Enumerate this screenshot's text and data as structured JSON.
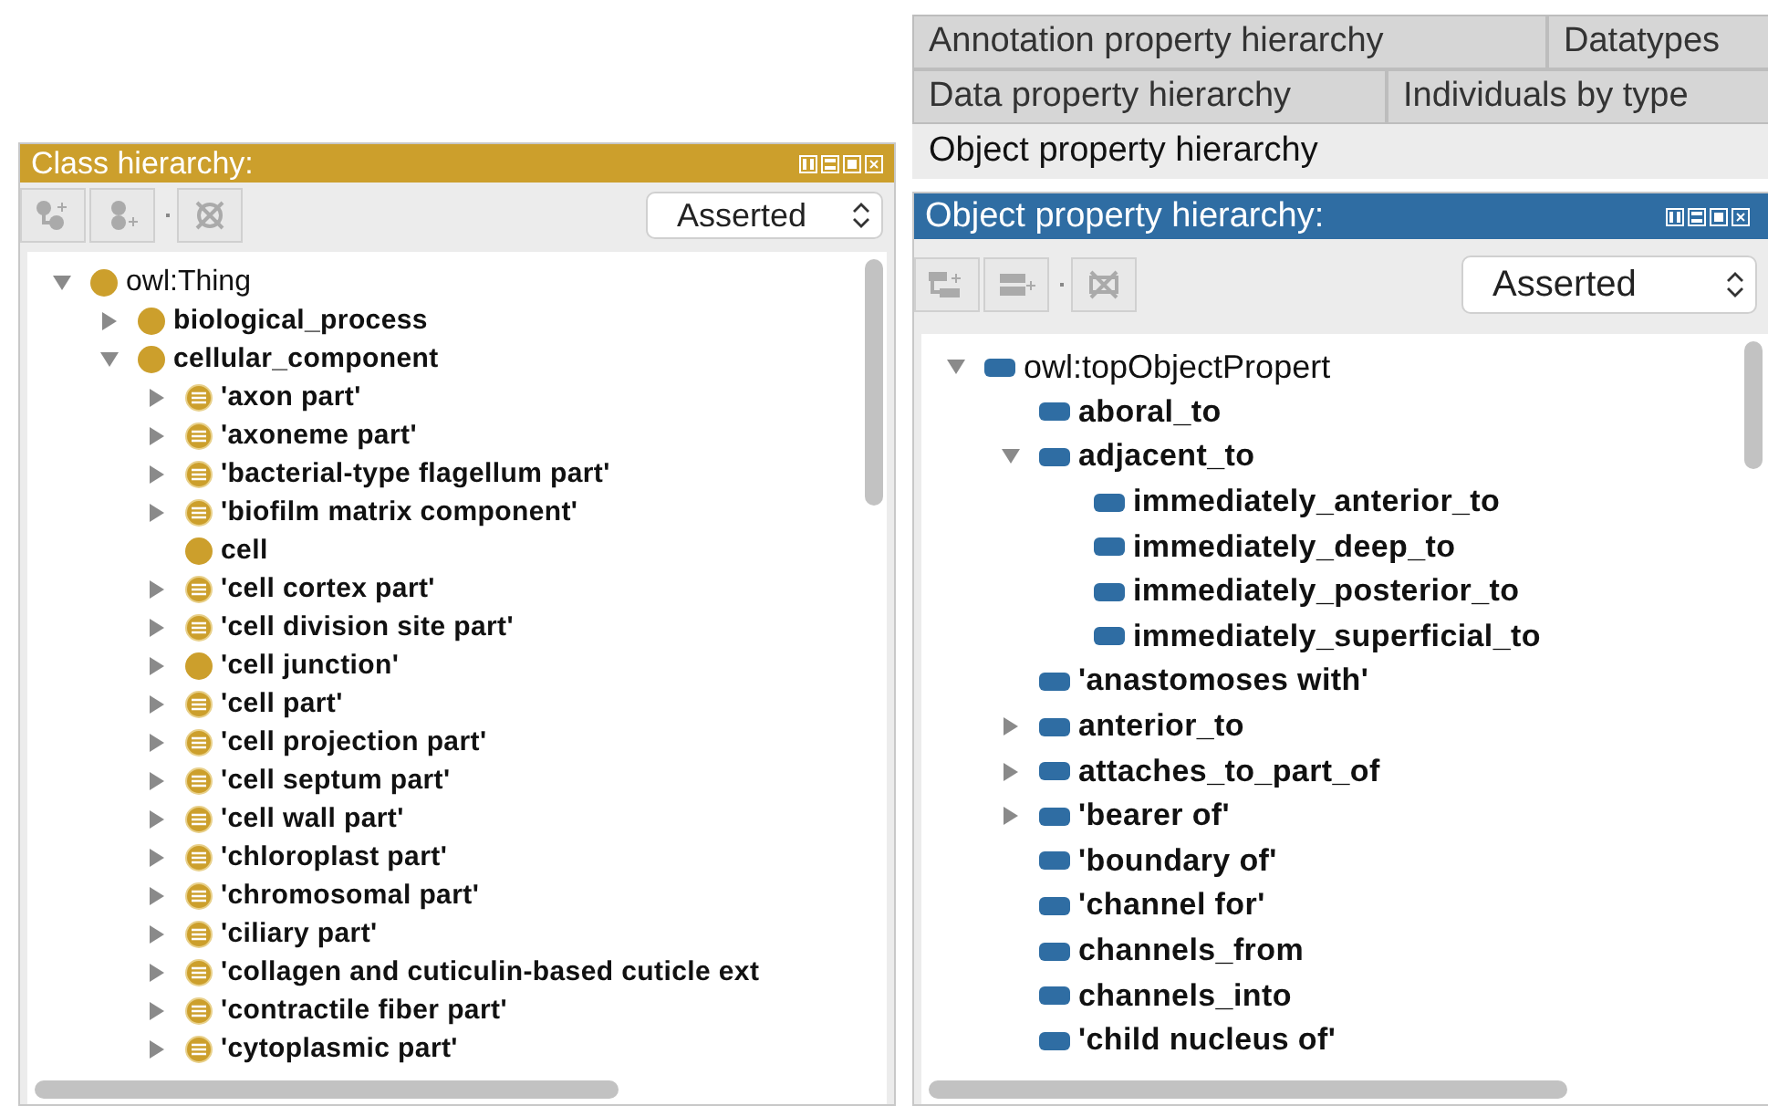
{
  "class_panel": {
    "title": "Class hierarchy:",
    "color": "#cc9f2c",
    "mode": "Asserted",
    "tree": [
      {
        "label": "owl:Thing",
        "kind": "class",
        "bold": false,
        "expanded": true,
        "children": [
          {
            "label": "biological_process",
            "kind": "class",
            "bold": true,
            "expanded": false
          },
          {
            "label": "cellular_component",
            "kind": "class",
            "bold": true,
            "expanded": true,
            "children": [
              {
                "label": "'axon part'",
                "kind": "defined-class",
                "bold": true,
                "expanded": false
              },
              {
                "label": "'axoneme part'",
                "kind": "defined-class",
                "bold": true,
                "expanded": false
              },
              {
                "label": "'bacterial-type flagellum part'",
                "kind": "defined-class",
                "bold": true,
                "expanded": false
              },
              {
                "label": "'biofilm matrix component'",
                "kind": "defined-class",
                "bold": true,
                "expanded": false
              },
              {
                "label": "cell",
                "kind": "class",
                "bold": true
              },
              {
                "label": "'cell cortex part'",
                "kind": "defined-class",
                "bold": true,
                "expanded": false
              },
              {
                "label": "'cell division site part'",
                "kind": "defined-class",
                "bold": true,
                "expanded": false
              },
              {
                "label": "'cell junction'",
                "kind": "class",
                "bold": true,
                "expanded": false
              },
              {
                "label": "'cell part'",
                "kind": "defined-class",
                "bold": true,
                "expanded": false
              },
              {
                "label": "'cell projection part'",
                "kind": "defined-class",
                "bold": true,
                "expanded": false
              },
              {
                "label": "'cell septum part'",
                "kind": "defined-class",
                "bold": true,
                "expanded": false
              },
              {
                "label": "'cell wall part'",
                "kind": "defined-class",
                "bold": true,
                "expanded": false
              },
              {
                "label": "'chloroplast part'",
                "kind": "defined-class",
                "bold": true,
                "expanded": false
              },
              {
                "label": "'chromosomal part'",
                "kind": "defined-class",
                "bold": true,
                "expanded": false
              },
              {
                "label": "'ciliary part'",
                "kind": "defined-class",
                "bold": true,
                "expanded": false
              },
              {
                "label": "'collagen and cuticulin-based cuticle ext",
                "kind": "defined-class",
                "bold": true,
                "expanded": false
              },
              {
                "label": "'contractile fiber part'",
                "kind": "defined-class",
                "bold": true,
                "expanded": false
              },
              {
                "label": "'cytoplasmic part'",
                "kind": "defined-class",
                "bold": true,
                "expanded": false
              }
            ]
          }
        ]
      }
    ]
  },
  "tab_rows": [
    [
      {
        "label": "Annotation property hierarchy",
        "selected": false
      },
      {
        "label": "Datatypes",
        "selected": false
      }
    ],
    [
      {
        "label": "Data property hierarchy",
        "selected": false
      },
      {
        "label": "Individuals by type",
        "selected": false
      }
    ],
    [
      {
        "label": "Object property hierarchy",
        "selected": true
      }
    ]
  ],
  "property_panel": {
    "title": "Object property hierarchy:",
    "color": "#2f6da3",
    "mode": "Asserted",
    "tree": [
      {
        "label": "owl:topObjectPropert",
        "kind": "property",
        "bold": false,
        "expanded": true,
        "children": [
          {
            "label": "aboral_to",
            "kind": "property",
            "bold": true
          },
          {
            "label": "adjacent_to",
            "kind": "property",
            "bold": true,
            "expanded": true,
            "children": [
              {
                "label": "immediately_anterior_to",
                "kind": "property",
                "bold": true
              },
              {
                "label": "immediately_deep_to",
                "kind": "property",
                "bold": true
              },
              {
                "label": "immediately_posterior_to",
                "kind": "property",
                "bold": true
              },
              {
                "label": "immediately_superficial_to",
                "kind": "property",
                "bold": true
              }
            ]
          },
          {
            "label": "'anastomoses with'",
            "kind": "property",
            "bold": true
          },
          {
            "label": "anterior_to",
            "kind": "property",
            "bold": true,
            "expanded": false
          },
          {
            "label": "attaches_to_part_of",
            "kind": "property",
            "bold": true,
            "expanded": false
          },
          {
            "label": "'bearer of'",
            "kind": "property",
            "bold": true,
            "expanded": false
          },
          {
            "label": "'boundary of'",
            "kind": "property",
            "bold": true
          },
          {
            "label": "'channel for'",
            "kind": "property",
            "bold": true
          },
          {
            "label": "channels_from",
            "kind": "property",
            "bold": true
          },
          {
            "label": "channels_into",
            "kind": "property",
            "bold": true
          },
          {
            "label": "'child nucleus of'",
            "kind": "property",
            "bold": true
          }
        ]
      }
    ]
  }
}
